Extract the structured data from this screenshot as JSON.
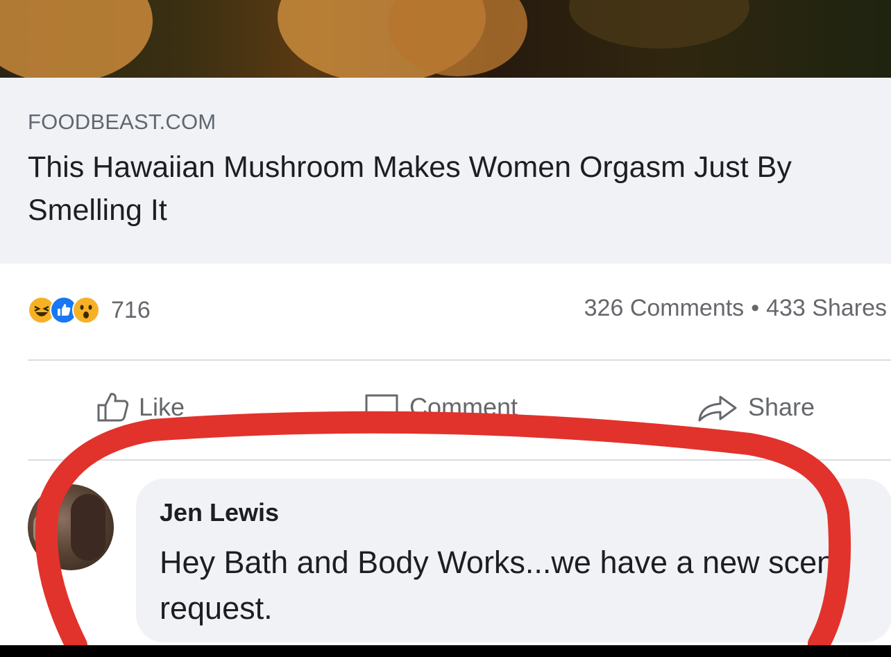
{
  "post": {
    "source": "FOODBEAST.COM",
    "headline": "This Hawaiian Mushroom Makes Women Orgasm Just By Smelling It",
    "reaction_icons": [
      "haha-icon",
      "like-icon",
      "wow-icon"
    ],
    "reaction_count": "716",
    "comments": "326 Comments",
    "separator": "•",
    "shares": "433 Shares"
  },
  "actions": {
    "like": "Like",
    "comment": "Comment",
    "share": "Share"
  },
  "comment": {
    "author": "Jen Lewis",
    "text": "Hey Bath and Body Works...we have a new scent request."
  },
  "colors": {
    "annotation_circle": "#e2322c",
    "like_blue": "#1877f2",
    "emoji_yellow": "#f7b125"
  }
}
